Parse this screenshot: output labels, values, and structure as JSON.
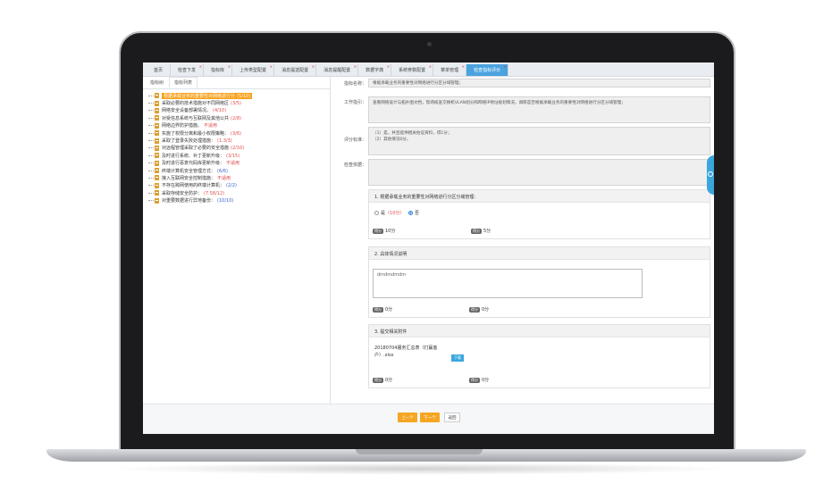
{
  "tabs": [
    {
      "label": "首页",
      "active": false
    },
    {
      "label": "检查下发",
      "active": false
    },
    {
      "label": "指标库",
      "active": false
    },
    {
      "label": "上传类型配置",
      "active": false
    },
    {
      "label": "消息提送配置",
      "active": false
    },
    {
      "label": "消息提醒配置",
      "active": false
    },
    {
      "label": "数据字典",
      "active": false
    },
    {
      "label": "系统参数配置",
      "active": false
    },
    {
      "label": "菜单管理",
      "active": false
    },
    {
      "label": "检查指标评价",
      "active": true
    }
  ],
  "subtabs": [
    "指标树",
    "指标列表"
  ],
  "tree": [
    {
      "text": "根据承载业务的重要性对网络进行分",
      "score": "(5/10)",
      "color": "selected",
      "selected": true
    },
    {
      "text": "采取必要的技术措施对不同网络区",
      "score": "(3/5)",
      "color": "red"
    },
    {
      "text": "网络安全设备部署情况。",
      "score": "(4/10)",
      "color": "red"
    },
    {
      "text": "对受信息系统与互联网及其他公共",
      "score": "(2/8)",
      "color": "red"
    },
    {
      "text": "网络边界防护措施。",
      "score": "不适用",
      "color": "red"
    },
    {
      "text": "实施了权限分离和最小权限策略：",
      "score": "(3/6)",
      "color": "red"
    },
    {
      "text": "采取了登录失败处理措施：",
      "score": "(1.3/3)",
      "color": "red"
    },
    {
      "text": "对远程管理采取了必要的安全措施",
      "score": "(2/10)",
      "color": "red"
    },
    {
      "text": "及时进行系统、补丁更新升级：",
      "score": "(3/15)",
      "color": "red"
    },
    {
      "text": "及时进行恶意代码库更新升级：",
      "score": "不适用",
      "color": "red"
    },
    {
      "text": "终端计算机安全管理方式：",
      "score": "(6/6)",
      "color": "blue"
    },
    {
      "text": "接入互联网安全控制措施：",
      "score": "不适用",
      "color": "red"
    },
    {
      "text": "不存在跨网使用的终端计算机：",
      "score": "(2/2)",
      "color": "blue"
    },
    {
      "text": "采取存储安全防护：",
      "score": "(7.58/12)",
      "color": "red"
    },
    {
      "text": "对重要数据进行异地备份：",
      "score": "(10/10)",
      "color": "blue"
    }
  ],
  "form": {
    "name_label": "指标名称：",
    "name_value": "根据承载业务的重要性对网络进行分区分域管理；",
    "guide_label": "工作指引：",
    "guide_value": "查看网络设计与拓扑图文档，现场核查交换机VLAN划分和网络IP地址规划情况，调研是否根据承载业务的重要性对网络进行分区分域管理；",
    "criteria_label": "评分标准：",
    "criteria_line1": "（1）是，并且提供相关佐证资料，得1分；",
    "criteria_line2": "（2）其他情况0分。",
    "evidence_label": "检查依据：",
    "evidence_value": ""
  },
  "cards": [
    {
      "title": "1. 根据承载业务的重要性对网络进行分区分域管理：",
      "option_yes": "是",
      "option_yes_score": "（10分）",
      "option_no": "否",
      "score_label": "得分",
      "score_value": "10分",
      "points_label": "得分",
      "points_value": "5分"
    },
    {
      "title": "2. 具体情况说明",
      "textarea_value": "dmdmdmdm",
      "score_label": "得分",
      "score_value": "0分",
      "points_label": "得分",
      "points_value": "0分"
    },
    {
      "title": "3. 提交相关附件",
      "file_name": "20180704服务汇总表（打赢客户）.xlsx",
      "download_label": "下载",
      "score_label": "得分",
      "score_value": "0分",
      "points_label": "得分",
      "points_value": "0分"
    }
  ],
  "buttons": {
    "prev": "上一个",
    "next": "下一个",
    "back": "返回"
  }
}
